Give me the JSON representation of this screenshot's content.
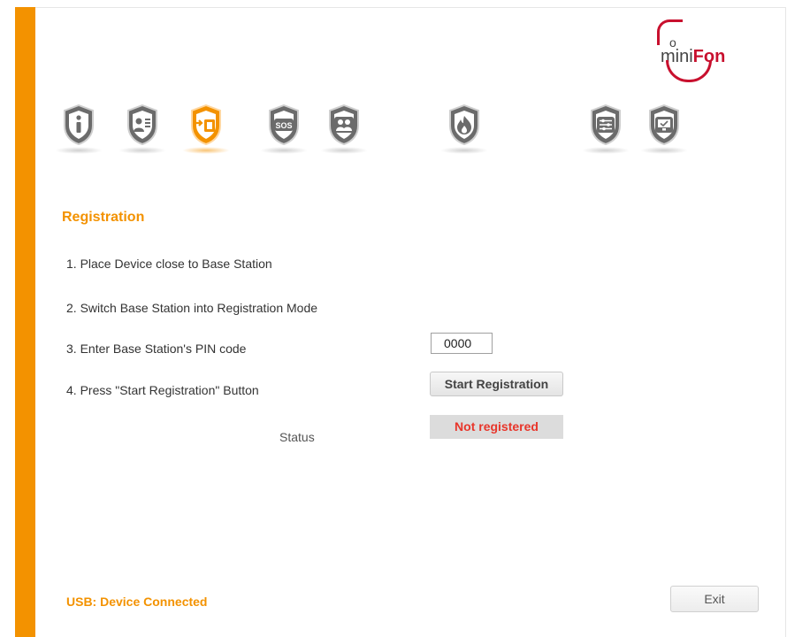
{
  "brand": {
    "logo_mini": "mini",
    "logo_fon": "Fon",
    "logo_o": "o"
  },
  "nav": {
    "items": [
      {
        "icon": "info-icon",
        "active": false
      },
      {
        "icon": "contact-card-icon",
        "active": false
      },
      {
        "icon": "registration-icon",
        "active": true
      },
      {
        "icon": "sos-icon",
        "active": false
      },
      {
        "icon": "contacts-group-icon",
        "active": false
      },
      {
        "icon": "fire-alarm-icon",
        "active": false
      },
      {
        "icon": "settings-sliders-icon",
        "active": false
      },
      {
        "icon": "display-icon",
        "active": false
      }
    ]
  },
  "registration": {
    "title": "Registration",
    "steps": [
      "1. Place Device close to Base Station",
      "2. Switch Base Station into Registration Mode",
      "3. Enter Base Station's PIN code",
      "4. Press \"Start Registration\" Button"
    ],
    "pin_value": "0000",
    "start_button": "Start Registration",
    "status_label": "Status",
    "status_value": "Not registered"
  },
  "footer": {
    "usb_status": "USB: Device Connected",
    "exit_label": "Exit"
  },
  "colors": {
    "accent": "#f39200",
    "brand_red": "#c8102e",
    "status_error": "#e8362b",
    "icon_gray": "#6b6b6b"
  }
}
